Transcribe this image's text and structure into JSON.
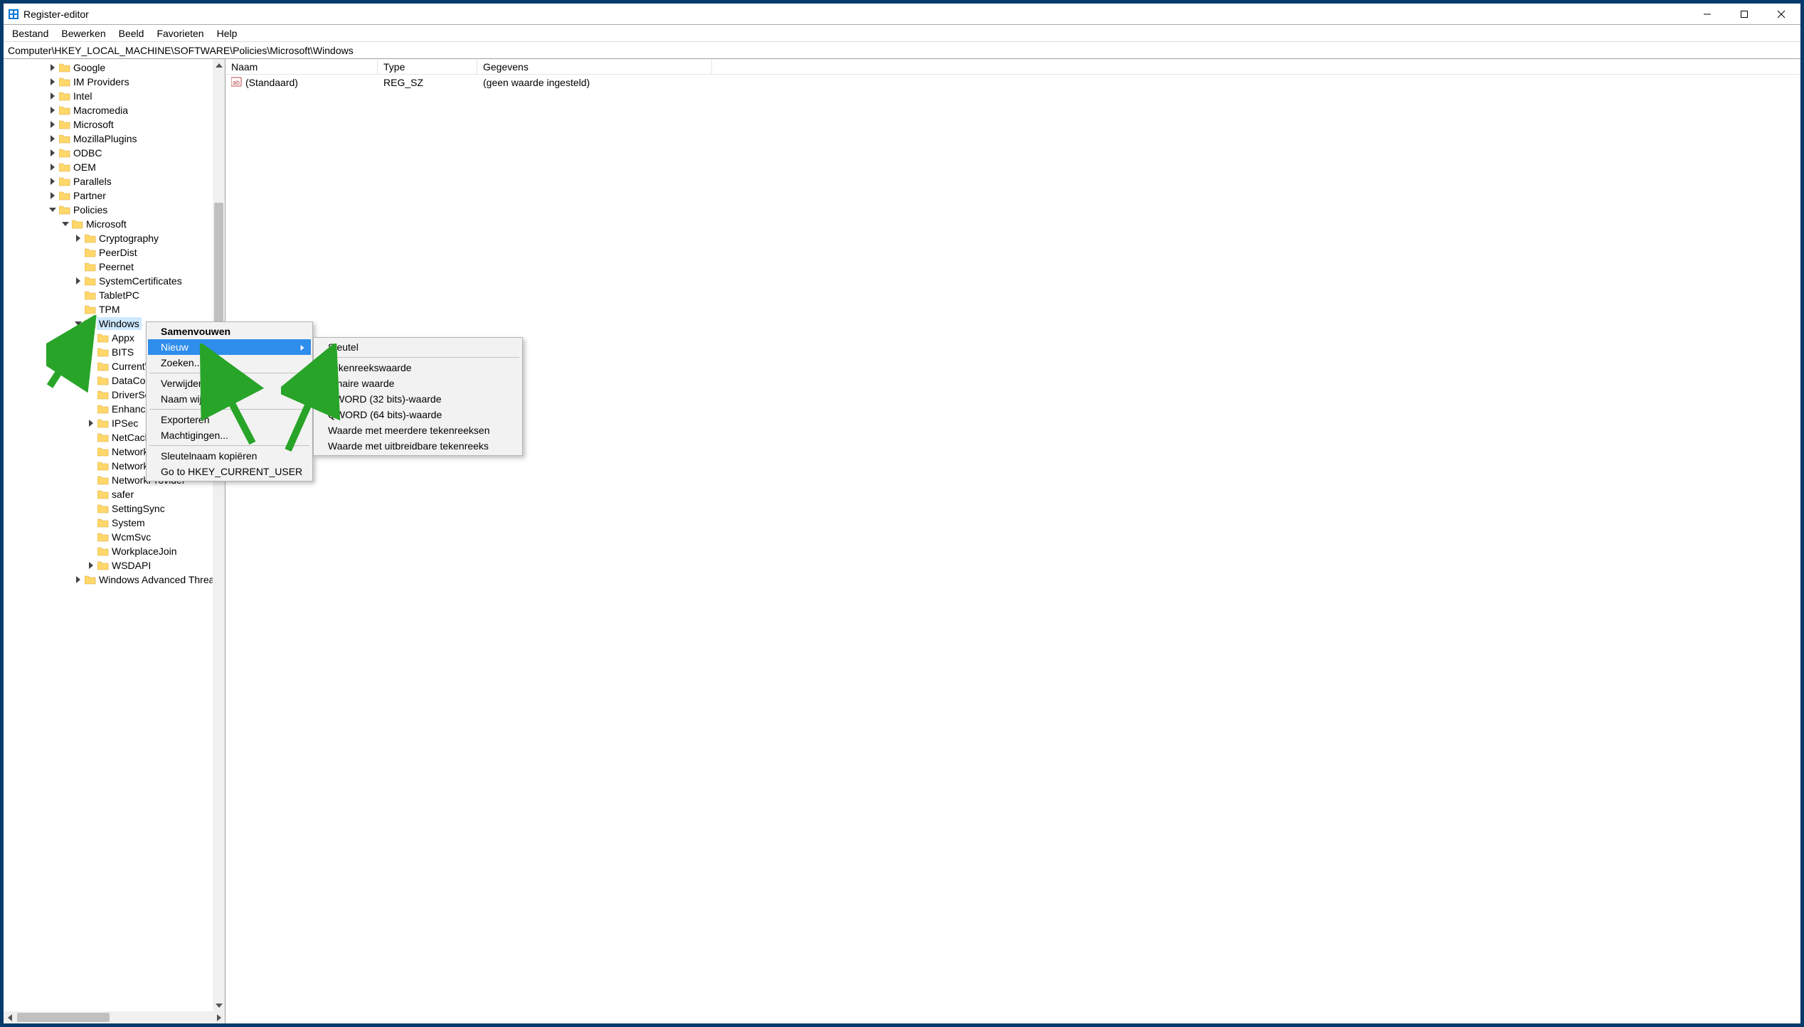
{
  "window": {
    "title": "Register-editor"
  },
  "menubar": {
    "items": [
      "Bestand",
      "Bewerken",
      "Beeld",
      "Favorieten",
      "Help"
    ]
  },
  "pathbar": {
    "path": "Computer\\HKEY_LOCAL_MACHINE\\SOFTWARE\\Policies\\Microsoft\\Windows"
  },
  "tree": {
    "nodes": [
      {
        "depth": 3,
        "expand": "closed",
        "label": "Google"
      },
      {
        "depth": 3,
        "expand": "closed",
        "label": "IM Providers"
      },
      {
        "depth": 3,
        "expand": "closed",
        "label": "Intel"
      },
      {
        "depth": 3,
        "expand": "closed",
        "label": "Macromedia"
      },
      {
        "depth": 3,
        "expand": "closed",
        "label": "Microsoft"
      },
      {
        "depth": 3,
        "expand": "closed",
        "label": "MozillaPlugins"
      },
      {
        "depth": 3,
        "expand": "closed",
        "label": "ODBC"
      },
      {
        "depth": 3,
        "expand": "closed",
        "label": "OEM"
      },
      {
        "depth": 3,
        "expand": "closed",
        "label": "Parallels"
      },
      {
        "depth": 3,
        "expand": "closed",
        "label": "Partner"
      },
      {
        "depth": 3,
        "expand": "open",
        "label": "Policies"
      },
      {
        "depth": 4,
        "expand": "open",
        "label": "Microsoft"
      },
      {
        "depth": 5,
        "expand": "closed",
        "label": "Cryptography"
      },
      {
        "depth": 5,
        "expand": "none",
        "label": "PeerDist"
      },
      {
        "depth": 5,
        "expand": "none",
        "label": "Peernet"
      },
      {
        "depth": 5,
        "expand": "closed",
        "label": "SystemCertificates"
      },
      {
        "depth": 5,
        "expand": "none",
        "label": "TabletPC"
      },
      {
        "depth": 5,
        "expand": "none",
        "label": "TPM"
      },
      {
        "depth": 5,
        "expand": "open",
        "label": "Windows",
        "selected": true
      },
      {
        "depth": 6,
        "expand": "none",
        "label": "Appx"
      },
      {
        "depth": 6,
        "expand": "none",
        "label": "BITS"
      },
      {
        "depth": 6,
        "expand": "none",
        "label": "CurrentVersion"
      },
      {
        "depth": 6,
        "expand": "none",
        "label": "DataCollection"
      },
      {
        "depth": 6,
        "expand": "none",
        "label": "DriverSearching"
      },
      {
        "depth": 6,
        "expand": "none",
        "label": "EnhancedStorageDevices"
      },
      {
        "depth": 6,
        "expand": "closed",
        "label": "IPSec"
      },
      {
        "depth": 6,
        "expand": "none",
        "label": "NetCache"
      },
      {
        "depth": 6,
        "expand": "none",
        "label": "Network Connections"
      },
      {
        "depth": 6,
        "expand": "none",
        "label": "NetworkConnectivityStatusIndicator"
      },
      {
        "depth": 6,
        "expand": "none",
        "label": "NetworkProvider"
      },
      {
        "depth": 6,
        "expand": "none",
        "label": "safer"
      },
      {
        "depth": 6,
        "expand": "none",
        "label": "SettingSync"
      },
      {
        "depth": 6,
        "expand": "none",
        "label": "System"
      },
      {
        "depth": 6,
        "expand": "none",
        "label": "WcmSvc"
      },
      {
        "depth": 6,
        "expand": "none",
        "label": "WorkplaceJoin"
      },
      {
        "depth": 6,
        "expand": "closed",
        "label": "WSDAPI"
      },
      {
        "depth": 5,
        "expand": "closed",
        "label": "Windows Advanced Threat Protection"
      }
    ]
  },
  "list": {
    "headers": {
      "name": "Naam",
      "type": "Type",
      "data": "Gegevens"
    },
    "rows": [
      {
        "name": "(Standaard)",
        "type": "REG_SZ",
        "data": "(geen waarde ingesteld)"
      }
    ]
  },
  "context_menu": {
    "items_primary": [
      {
        "label": "Samenvouwen",
        "bold": true
      },
      {
        "label": "Nieuw",
        "submenu": true,
        "highlight": true
      },
      {
        "label": "Zoeken..."
      },
      {
        "sep": true
      },
      {
        "label": "Verwijderen"
      },
      {
        "label": "Naam wijzigen"
      },
      {
        "sep": true
      },
      {
        "label": "Exporteren"
      },
      {
        "label": "Machtigingen..."
      },
      {
        "sep": true
      },
      {
        "label": "Sleutelnaam kopiëren"
      },
      {
        "label": "Go to HKEY_CURRENT_USER"
      }
    ],
    "items_submenu": [
      {
        "label": "Sleutel"
      },
      {
        "sep": true
      },
      {
        "label": "Tekenreekswaarde"
      },
      {
        "label": "Binaire waarde"
      },
      {
        "label": "DWORD (32 bits)-waarde"
      },
      {
        "label": "QWORD (64 bits)-waarde"
      },
      {
        "label": "Waarde met meerdere tekenreeksen"
      },
      {
        "label": "Waarde met uitbreidbare tekenreeks"
      }
    ]
  }
}
